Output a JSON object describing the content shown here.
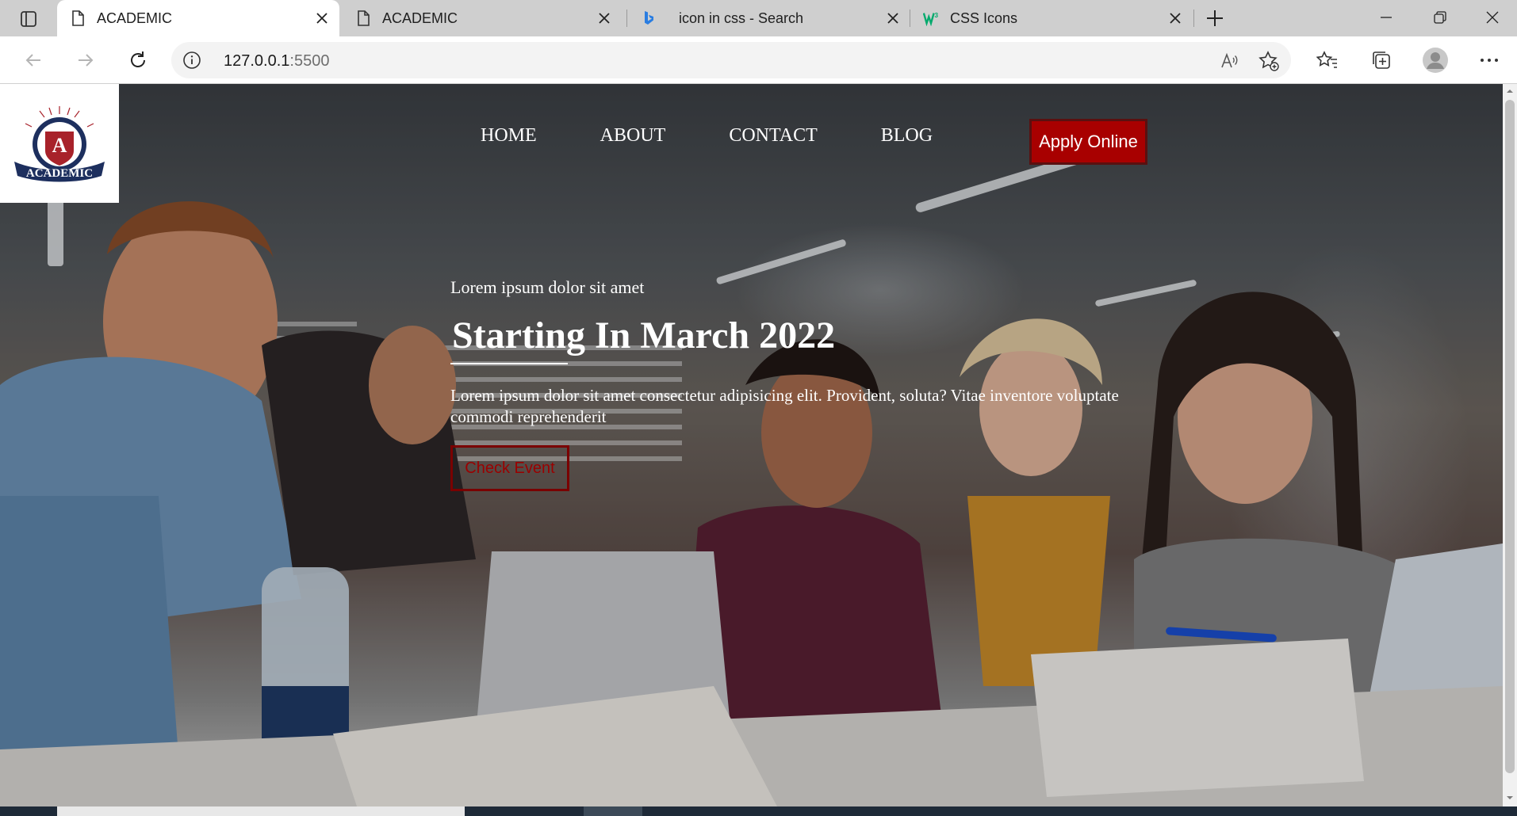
{
  "browser": {
    "tabs": [
      {
        "title": "ACADEMIC",
        "icon": "page-icon",
        "active": true
      },
      {
        "title": "ACADEMIC",
        "icon": "page-icon",
        "active": false
      },
      {
        "title": "icon in css - Search",
        "icon": "bing-icon",
        "active": false
      },
      {
        "title": "CSS Icons",
        "icon": "w3schools-icon",
        "active": false
      }
    ],
    "address": {
      "host": "127.0.0.1",
      "port": ":5500"
    }
  },
  "page": {
    "logo_text": "ACADEMIC",
    "nav": [
      "HOME",
      "ABOUT",
      "CONTACT",
      "BLOG"
    ],
    "apply_label": "Apply Online",
    "hero": {
      "subtitle": "Lorem ipsum dolor sit amet",
      "title": "Starting In March 2022",
      "description": "Lorem ipsum dolor sit amet consectetur adipisicing elit. Provident, soluta? Vitae inventore voluptate commodi reprehenderit",
      "button_label": "Check Event"
    }
  },
  "colors": {
    "accent": "#a80000",
    "button_border": "#7a0000"
  }
}
